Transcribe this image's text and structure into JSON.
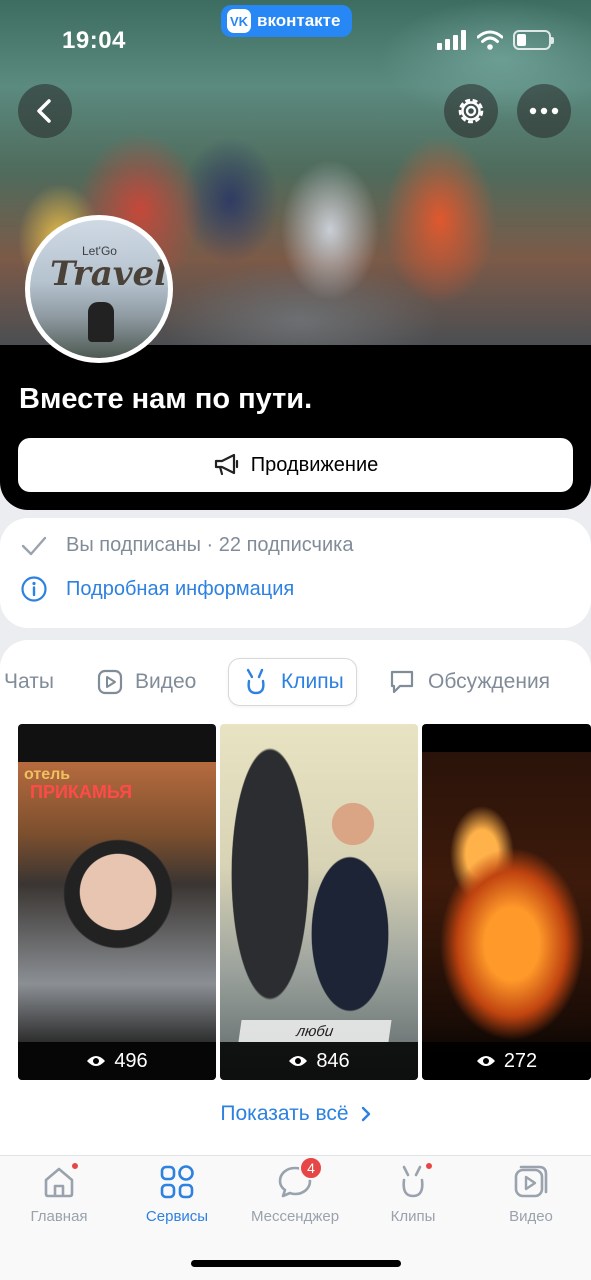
{
  "status_bar": {
    "time": "19:04",
    "app_badge": "вконтакте",
    "app_logo": "VK"
  },
  "cover": {
    "avatar_small_text": "Let'Go",
    "avatar_title": "Travel",
    "group_title": "Вместе нам по пути.",
    "promo_button": "Продвижение",
    "icons": [
      "back-arrow-icon",
      "gear-icon",
      "more-dots-icon",
      "megaphone-icon"
    ]
  },
  "info": {
    "subscribed_text": "Вы подписаны · 22 подписчика",
    "details_link": "Подробная информация"
  },
  "tabs": [
    {
      "label": "Чаты"
    },
    {
      "label": "Видео"
    },
    {
      "label": "Клипы",
      "active": true
    },
    {
      "label": "Обсуждения"
    }
  ],
  "clips": [
    {
      "views": "496",
      "sign_1": "отель",
      "sign_2": "ПРИКАМЬЯ"
    },
    {
      "views": "846",
      "caption": "люби"
    },
    {
      "views": "272"
    }
  ],
  "show_all": "Показать всё",
  "bottom_nav": [
    {
      "label": "Главная",
      "icon": "home-icon",
      "dot": true
    },
    {
      "label": "Сервисы",
      "icon": "services-icon",
      "active": true
    },
    {
      "label": "Мессенджер",
      "icon": "messenger-icon",
      "badge": "4"
    },
    {
      "label": "Клипы",
      "icon": "clips-icon",
      "dot": true
    },
    {
      "label": "Видео",
      "icon": "video-icon"
    }
  ],
  "colors": {
    "accent": "#2d81e0",
    "brand": "#2787f5",
    "badge": "#e64646"
  }
}
